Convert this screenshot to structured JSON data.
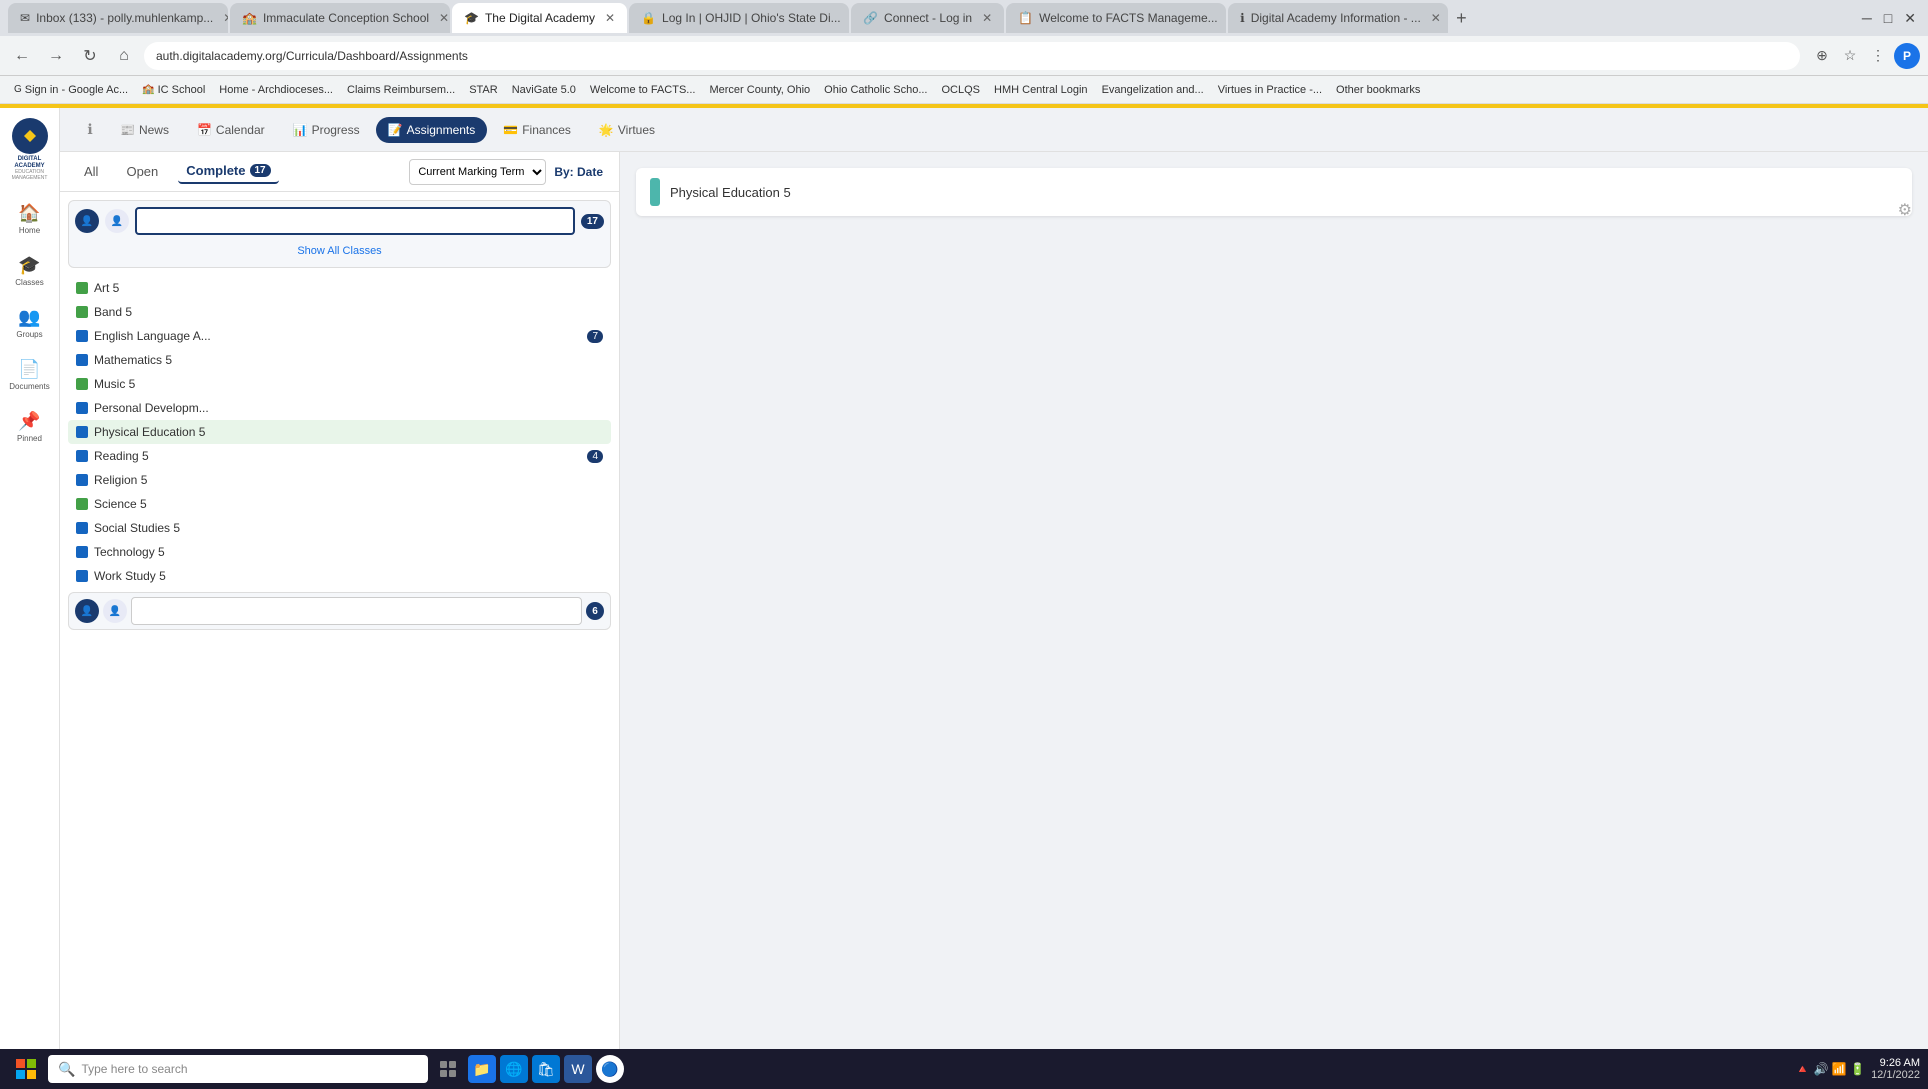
{
  "browser": {
    "tabs": [
      {
        "id": "tab1",
        "label": "Inbox (133) - polly.muhlenkamp...",
        "favicon": "✉",
        "active": false
      },
      {
        "id": "tab2",
        "label": "Immaculate Conception School",
        "favicon": "🏫",
        "active": false
      },
      {
        "id": "tab3",
        "label": "The Digital Academy",
        "favicon": "🎓",
        "active": true
      },
      {
        "id": "tab4",
        "label": "Log In | OHJID | Ohio's State Di...",
        "favicon": "🔒",
        "active": false
      },
      {
        "id": "tab5",
        "label": "Connect - Log in",
        "favicon": "🔗",
        "active": false
      },
      {
        "id": "tab6",
        "label": "Welcome to FACTS Manageme...",
        "favicon": "📋",
        "active": false
      },
      {
        "id": "tab7",
        "label": "Digital Academy Information - ...",
        "favicon": "ℹ",
        "active": false
      }
    ],
    "address": "auth.digitalacademy.org/Curricula/Dashboard/Assignments",
    "bookmarks": [
      {
        "label": "Sign in - Google Ac...",
        "icon": "G"
      },
      {
        "label": "IC School",
        "icon": "🏫"
      },
      {
        "label": "Home - Archdiocese...",
        "icon": "⛪"
      },
      {
        "label": "Claims Reimbursem...",
        "icon": "💰"
      },
      {
        "label": "STAR",
        "icon": "⭐"
      },
      {
        "label": "NaviGate 5.0",
        "icon": "🧭"
      },
      {
        "label": "Welcome to FACTS...",
        "icon": "📋"
      },
      {
        "label": "Mercer County, Ohio",
        "icon": "📍"
      },
      {
        "label": "Ohio Catholic Scho...",
        "icon": "✝"
      },
      {
        "label": "OCLQS",
        "icon": "📊"
      },
      {
        "label": "HMH Central Login",
        "icon": "📚"
      },
      {
        "label": "Evangelization and...",
        "icon": "✝"
      },
      {
        "label": "Virtues in Practice -...",
        "icon": "🌟"
      },
      {
        "label": "Other bookmarks",
        "icon": "📁"
      }
    ]
  },
  "sidebar": {
    "logo_text": "DIGITAL ACADEMY",
    "logo_sub": "EDUCATION MANAGEMENT SYSTEM",
    "items": [
      {
        "id": "home",
        "label": "Home",
        "icon": "🏠"
      },
      {
        "id": "classes",
        "label": "Classes",
        "icon": "🎓"
      },
      {
        "id": "groups",
        "label": "Groups",
        "icon": "👥"
      },
      {
        "id": "documents",
        "label": "Documents",
        "icon": "📄"
      },
      {
        "id": "pinned",
        "label": "Pinned",
        "icon": "📌"
      }
    ]
  },
  "nav_tabs": [
    {
      "id": "news",
      "label": "News",
      "icon": "📰"
    },
    {
      "id": "calendar",
      "label": "Calendar",
      "icon": "📅"
    },
    {
      "id": "progress",
      "label": "Progress",
      "icon": "📊"
    },
    {
      "id": "assignments",
      "label": "Assignments",
      "icon": "📝",
      "active": true
    },
    {
      "id": "finances",
      "label": "Finances",
      "icon": "💳"
    },
    {
      "id": "virtues",
      "label": "Virtues",
      "icon": "🌟"
    }
  ],
  "filter_tabs": [
    {
      "id": "all",
      "label": "All"
    },
    {
      "id": "open",
      "label": "Open"
    },
    {
      "id": "complete",
      "label": "Complete",
      "badge": "17",
      "active": true
    }
  ],
  "marking_term": "Current Marking Term",
  "by_date": "By: Date",
  "show_all_classes": "Show All Classes",
  "classes": [
    {
      "name": "Art 5",
      "color": "#43a047"
    },
    {
      "name": "Band 5",
      "color": "#43a047"
    },
    {
      "name": "English Language A...",
      "color": "#1565c0",
      "badge": "7"
    },
    {
      "name": "Mathematics 5",
      "color": "#1565c0"
    },
    {
      "name": "Music 5",
      "color": "#43a047"
    },
    {
      "name": "Personal Developm...",
      "color": "#1565c0"
    },
    {
      "name": "Physical Education 5",
      "color": "#1565c0",
      "selected": true
    },
    {
      "name": "Reading 5",
      "color": "#1565c0",
      "badge": "4"
    },
    {
      "name": "Religion 5",
      "color": "#1565c0"
    },
    {
      "name": "Science 5",
      "color": "#43a047"
    },
    {
      "name": "Social Studies 5",
      "color": "#1565c0"
    },
    {
      "name": "Technology 5",
      "color": "#1565c0"
    },
    {
      "name": "Work Study 5",
      "color": "#1565c0"
    }
  ],
  "selected_class": "Physical Education 5",
  "assignment_color": "#4db6ac",
  "taskbar": {
    "search_placeholder": "Type here to search",
    "time": "9:26 AM",
    "date": "12/1/2022"
  }
}
